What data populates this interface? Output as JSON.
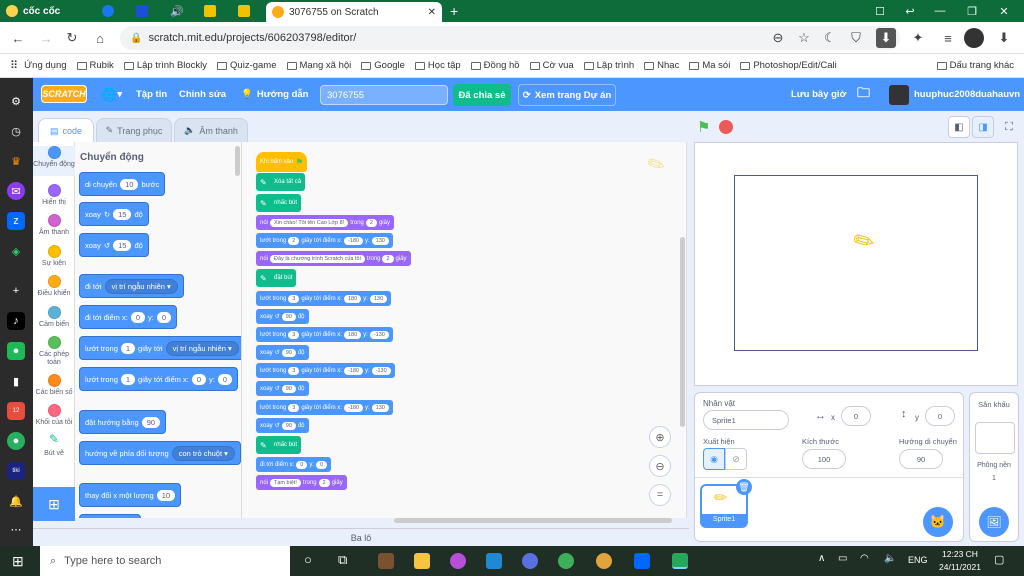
{
  "browser": {
    "brand": "cốc cốc",
    "tab_title": "3076755 on Scratch",
    "url": "scratch.mit.edu/projects/606203798/editor/",
    "bookmarks": [
      "Ứng dụng",
      "Rubik",
      "Lập trình Blockly",
      "Quiz-game",
      "Mạng xã hội",
      "Google",
      "Học tập",
      "Đồng hồ",
      "Cờ vua",
      "Lập trình",
      "Nhạc",
      "Ma sói",
      "Photoshop/Edit/Cali"
    ],
    "bookmarks_other": "Dấu trang khác"
  },
  "menubar": {
    "logo": "SCRATCH",
    "file": "Tập tin",
    "edit": "Chỉnh sửa",
    "tutorials": "Hướng dẫn",
    "project_title": "3076755",
    "share": "Đã chia sẻ",
    "see_project": "Xem trang Dự án",
    "save_now": "Lưu bây giờ",
    "username": "huuphuc2008duahauvn"
  },
  "editor_tabs": {
    "code": "code",
    "costumes": "Trang phục",
    "sounds": "Âm thanh"
  },
  "categories": [
    {
      "label": "Chuyển động",
      "color": "#4c97ff"
    },
    {
      "label": "Hiển thị",
      "color": "#9966ff"
    },
    {
      "label": "Âm thanh",
      "color": "#cf63cf"
    },
    {
      "label": "Sự kiện",
      "color": "#ffbf00"
    },
    {
      "label": "Điều khiển",
      "color": "#ffab19"
    },
    {
      "label": "Cảm biến",
      "color": "#5cb1d6"
    },
    {
      "label": "Các phép toán",
      "color": "#59c059"
    },
    {
      "label": "Các biến số",
      "color": "#ff8c1a"
    },
    {
      "label": "Khối của tôi",
      "color": "#ff6680"
    },
    {
      "label": "Bút vẽ",
      "color": "#0fbd8c"
    }
  ],
  "palette": {
    "title": "Chuyển động",
    "move": {
      "a": "di chuyển",
      "v": "10",
      "b": "bước"
    },
    "turn_right": {
      "a": "xoay",
      "v": "15",
      "b": "độ"
    },
    "turn_left": {
      "a": "xoay",
      "v": "15",
      "b": "độ"
    },
    "goto": {
      "a": "đi tới",
      "d": "vị trí ngẫu nhiên"
    },
    "goto_xy": {
      "a": "đi tới điểm x:",
      "x": "0",
      "y_label": "y:",
      "y": "0"
    },
    "glide": {
      "a": "lướt trong",
      "v": "1",
      "b": "giây tới",
      "d": "vị trí ngẫu nhiên"
    },
    "glide_xy": {
      "a": "lướt trong",
      "v": "1",
      "b": "giây tới điểm x:",
      "x": "0",
      "y_label": "y:",
      "y": "0"
    },
    "point": {
      "a": "đặt hướng bằng",
      "v": "90"
    },
    "point_towards": {
      "a": "hướng về phía đối tượng",
      "d": "con trỏ chuột"
    },
    "change_x": {
      "a": "thay đổi x một lượng",
      "v": "10"
    }
  },
  "script": {
    "hat": "Khi bấm vào",
    "clear": "Xóa tất cả",
    "penup": "nhấc bút",
    "say1": {
      "a": "nói",
      "msg": "Xin chào! Tôi tên Cao      Lớp 8!",
      "b": "trong",
      "v": "2",
      "c": "giây"
    },
    "glide1": {
      "a": "lướt trong",
      "t": "2",
      "b": "giây tới điểm x:",
      "x": "-180",
      "y_label": "y:",
      "y": "130"
    },
    "say2": {
      "a": "nói",
      "msg": "Đây là chương trình Scratch của tôi",
      "b": "trong",
      "v": "2",
      "c": "giây"
    },
    "pendown": "đặt bút",
    "g2": {
      "a": "lướt trong",
      "t": "3",
      "b": "giây tới điểm x:",
      "x": "180",
      "y_label": "y:",
      "y": "130"
    },
    "turn": {
      "a": "xoay",
      "v": "90",
      "b": "độ"
    },
    "g3": {
      "a": "lướt trong",
      "t": "3",
      "b": "giây tới điểm x:",
      "x": "180",
      "y_label": "y:",
      "y": "-130"
    },
    "g4": {
      "a": "lướt trong",
      "t": "3",
      "b": "giây tới điểm x:",
      "x": "-180",
      "y_label": "y:",
      "y": "-130"
    },
    "g5": {
      "a": "lướt trong",
      "t": "3",
      "b": "giây tới điểm x:",
      "x": "-180",
      "y_label": "y:",
      "y": "130"
    },
    "penup2": "nhấc bút",
    "goxy": {
      "a": "đi tới điểm x:",
      "x": "0",
      "y_label": "y:",
      "y": "0"
    },
    "bye": {
      "a": "nói",
      "msg": "Tạm biệt!",
      "b": "trong",
      "v": "2",
      "c": "giây"
    }
  },
  "sprite_info": {
    "label_sprite": "Nhân vật",
    "sprite_name": "Sprite1",
    "x_label": "x",
    "x": "0",
    "y_label": "y",
    "y": "0",
    "show_label": "Xuất hiện",
    "size_label": "Kích thước",
    "size": "100",
    "direction_label": "Hướng di chuyển",
    "direction": "90",
    "thumb_name": "Sprite1"
  },
  "stage_panel": {
    "title": "Sân khấu",
    "backdrops_label": "Phông nền",
    "backdrops_count": "1"
  },
  "backpack": "Ba lô",
  "taskbar": {
    "search": "Type here to search",
    "lang": "ENG",
    "time": "12:23 CH",
    "date": "24/11/2021"
  }
}
